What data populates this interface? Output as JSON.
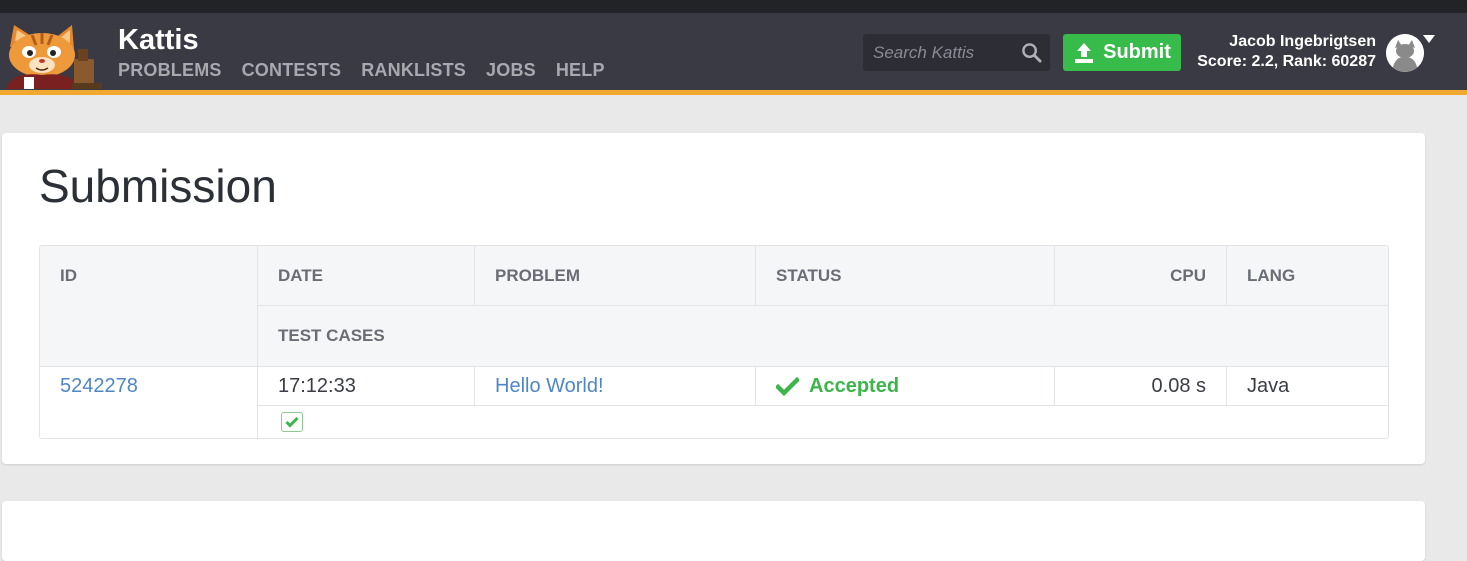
{
  "brand": {
    "name": "Kattis"
  },
  "nav": {
    "items": [
      "PROBLEMS",
      "CONTESTS",
      "RANKLISTS",
      "JOBS",
      "HELP"
    ]
  },
  "search": {
    "placeholder": "Search Kattis",
    "icon": "search-icon"
  },
  "submit": {
    "label": "Submit",
    "icon": "upload-icon"
  },
  "user": {
    "name": "Jacob Ingebrigtsen",
    "stats": "Score: 2.2, Rank: 60287"
  },
  "page": {
    "title": "Submission"
  },
  "table": {
    "headers": {
      "id": "ID",
      "date": "DATE",
      "problem": "PROBLEM",
      "status": "STATUS",
      "cpu": "CPU",
      "lang": "LANG",
      "test_cases": "TEST CASES"
    },
    "row": {
      "id": "5242278",
      "date": "17:12:33",
      "problem": "Hello World!",
      "status": "Accepted",
      "cpu": "0.08 s",
      "lang": "Java"
    },
    "test_cases": [
      {
        "result": "accepted",
        "icon": "check-icon"
      }
    ]
  },
  "colors": {
    "accent": "#f0a830",
    "navbar": "#3a3a44",
    "submit": "#37bb4a",
    "link": "#4f86c6",
    "accepted": "#3cb54a"
  }
}
